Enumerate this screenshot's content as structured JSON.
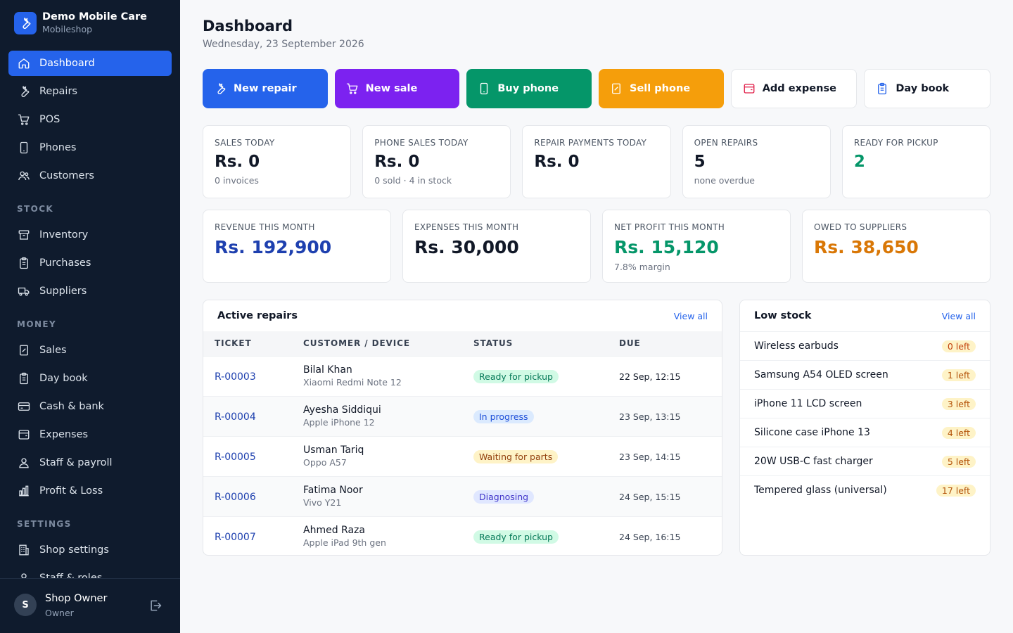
{
  "brand": {
    "name": "Demo Mobile Care",
    "subtitle": "Mobileshop"
  },
  "nav": {
    "dashboard": "Dashboard",
    "repairs": "Repairs",
    "pos": "POS",
    "phones": "Phones",
    "customers": "Customers",
    "stock_section": "STOCK",
    "inventory": "Inventory",
    "purchases": "Purchases",
    "suppliers": "Suppliers",
    "money_section": "MONEY",
    "sales": "Sales",
    "day_book": "Day book",
    "cash_bank": "Cash & bank",
    "expenses": "Expenses",
    "staff_payroll": "Staff & payroll",
    "profit_loss": "Profit & Loss",
    "settings_section": "SETTINGS",
    "shop_settings": "Shop settings",
    "staff_roles": "Staff & roles"
  },
  "user": {
    "initial": "S",
    "name": "Shop Owner",
    "role": "Owner"
  },
  "header": {
    "title": "Dashboard",
    "date": "Wednesday, 23 September 2026"
  },
  "actions": {
    "new_repair": "New repair",
    "new_sale": "New sale",
    "buy_phone": "Buy phone",
    "sell_phone": "Sell phone",
    "add_expense": "Add expense",
    "day_book": "Day book"
  },
  "stats_today": [
    {
      "label": "SALES TODAY",
      "value": "Rs. 0",
      "sub": "0 invoices"
    },
    {
      "label": "PHONE SALES TODAY",
      "value": "Rs. 0",
      "sub": "0 sold · 4 in stock"
    },
    {
      "label": "REPAIR PAYMENTS TODAY",
      "value": "Rs. 0",
      "sub": ""
    },
    {
      "label": "OPEN REPAIRS",
      "value": "5",
      "sub": "none overdue"
    },
    {
      "label": "READY FOR PICKUP",
      "value": "2",
      "sub": ""
    }
  ],
  "stats_month": [
    {
      "label": "REVENUE THIS MONTH",
      "value": "Rs. 192,900",
      "sub": ""
    },
    {
      "label": "EXPENSES THIS MONTH",
      "value": "Rs. 30,000",
      "sub": ""
    },
    {
      "label": "NET PROFIT THIS MONTH",
      "value": "Rs. 15,120",
      "sub": "7.8% margin"
    },
    {
      "label": "OWED TO SUPPLIERS",
      "value": "Rs. 38,650",
      "sub": ""
    }
  ],
  "active_repairs": {
    "title": "Active repairs",
    "view_all": "View all",
    "columns": [
      "TICKET",
      "CUSTOMER / DEVICE",
      "STATUS",
      "DUE"
    ],
    "rows": [
      {
        "ticket": "R-00003",
        "customer": "Bilal Khan",
        "device": "Xiaomi Redmi Note 12",
        "status": "Ready for pickup",
        "due": "22 Sep, 12:15"
      },
      {
        "ticket": "R-00004",
        "customer": "Ayesha Siddiqui",
        "device": "Apple iPhone 12",
        "status": "In progress",
        "due": "23 Sep, 13:15"
      },
      {
        "ticket": "R-00005",
        "customer": "Usman Tariq",
        "device": "Oppo A57",
        "status": "Waiting for parts",
        "due": "23 Sep, 14:15"
      },
      {
        "ticket": "R-00006",
        "customer": "Fatima Noor",
        "device": "Vivo Y21",
        "status": "Diagnosing",
        "due": "24 Sep, 15:15"
      },
      {
        "ticket": "R-00007",
        "customer": "Ahmed Raza",
        "device": "Apple iPad 9th gen",
        "status": "Ready for pickup",
        "due": "24 Sep, 16:15"
      }
    ]
  },
  "low_stock": {
    "title": "Low stock",
    "view_all": "View all",
    "items": [
      {
        "name": "Wireless earbuds",
        "left": "0 left"
      },
      {
        "name": "Samsung A54 OLED screen",
        "left": "1 left"
      },
      {
        "name": "iPhone 11 LCD screen",
        "left": "3 left"
      },
      {
        "name": "Silicone case iPhone 13",
        "left": "4 left"
      },
      {
        "name": "20W USB-C fast charger",
        "left": "5 left"
      },
      {
        "name": "Tempered glass (universal)",
        "left": "17 left"
      }
    ]
  },
  "colors": {
    "sidebar_bg": "#0f1b2d",
    "primary": "#2563eb",
    "purple": "#7c22f0",
    "green": "#059669",
    "orange": "#f59e0b",
    "profit_green": "#059669",
    "revenue_navy": "#1e40af",
    "owed_orange": "#d97706"
  },
  "icons": {
    "brand": "wrench-icon",
    "dashboard": "home-icon",
    "repairs": "wrench-icon",
    "pos": "cart-icon",
    "phones": "smartphone-icon",
    "customers": "users-icon",
    "inventory": "box-icon",
    "purchases": "clipboard-icon",
    "suppliers": "truck-icon",
    "sales": "receipt-icon",
    "day_book": "clipboard-icon",
    "cash_bank": "credit-card-icon",
    "expenses": "wallet-icon",
    "staff_payroll": "user-icon",
    "profit_loss": "bar-chart-icon",
    "shop_settings": "building-icon",
    "staff_roles": "user-icon",
    "logout": "logout-icon"
  }
}
